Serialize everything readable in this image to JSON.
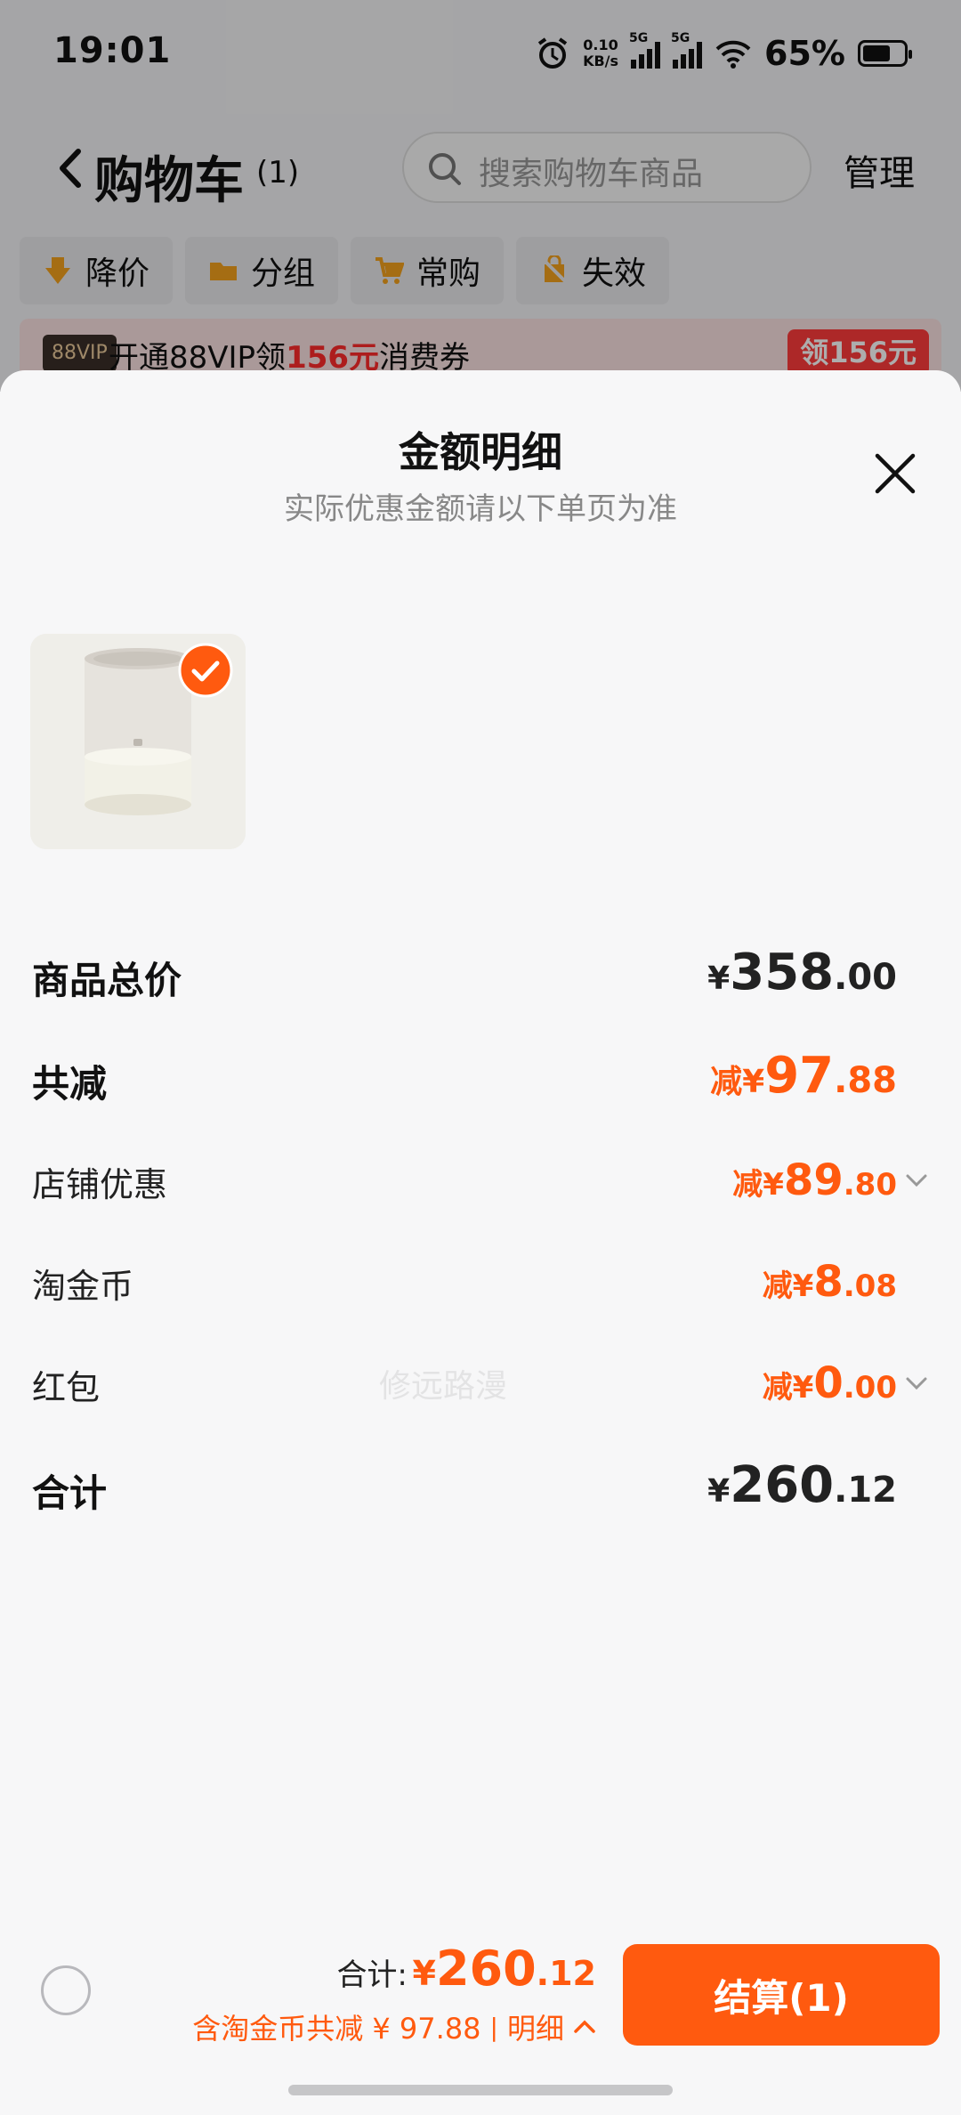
{
  "status_bar": {
    "time": "19:01",
    "net_speed_value": "0.10",
    "net_speed_unit": "KB/s",
    "sim1": "5G",
    "sim2": "5G",
    "battery": "65%"
  },
  "header": {
    "title": "购物车",
    "count": "(1)",
    "search_placeholder": "搜索购物车商品",
    "manage": "管理"
  },
  "filters": [
    {
      "label": "降价",
      "icon": "price-drop-icon"
    },
    {
      "label": "分组",
      "icon": "folder-icon"
    },
    {
      "label": "常购",
      "icon": "cart-icon"
    },
    {
      "label": "失效",
      "icon": "invalid-icon"
    }
  ],
  "vip_banner": {
    "badge": "88VIP",
    "text_before": "开通88VIP领",
    "highlight": "156元",
    "text_after": "消费券",
    "claim": "领156元"
  },
  "sheet": {
    "title": "金额明细",
    "subtitle": "实际优惠金额请以下单页为准",
    "watermark": "修远路漫",
    "rows": {
      "subtotal": {
        "label": "商品总价",
        "prefix": "¥",
        "int": "358",
        "dec": ".00"
      },
      "total_discount": {
        "label": "共减",
        "prefix": "减¥",
        "int": "97",
        "dec": ".88"
      },
      "shop_discount": {
        "label": "店铺优惠",
        "prefix": "减¥",
        "int": "89",
        "dec": ".80"
      },
      "taojinbi": {
        "label": "淘金币",
        "prefix": "减¥",
        "int": "8",
        "dec": ".08"
      },
      "red_packet": {
        "label": "红包",
        "prefix": "减¥",
        "int": "0",
        "dec": ".00"
      },
      "total": {
        "label": "合计",
        "prefix": "¥",
        "int": "260",
        "dec": ".12"
      }
    }
  },
  "bottom_bar": {
    "total_label": "合计:",
    "total_prefix": "¥",
    "total_int": "260",
    "total_dec": ".12",
    "discount_text": "含淘金币共减 ¥ 97.88",
    "separator": "|",
    "detail": "明细",
    "checkout": "结算(1)"
  },
  "colors": {
    "accent": "#ff5a0f",
    "vip_red": "#ff2b2b"
  }
}
